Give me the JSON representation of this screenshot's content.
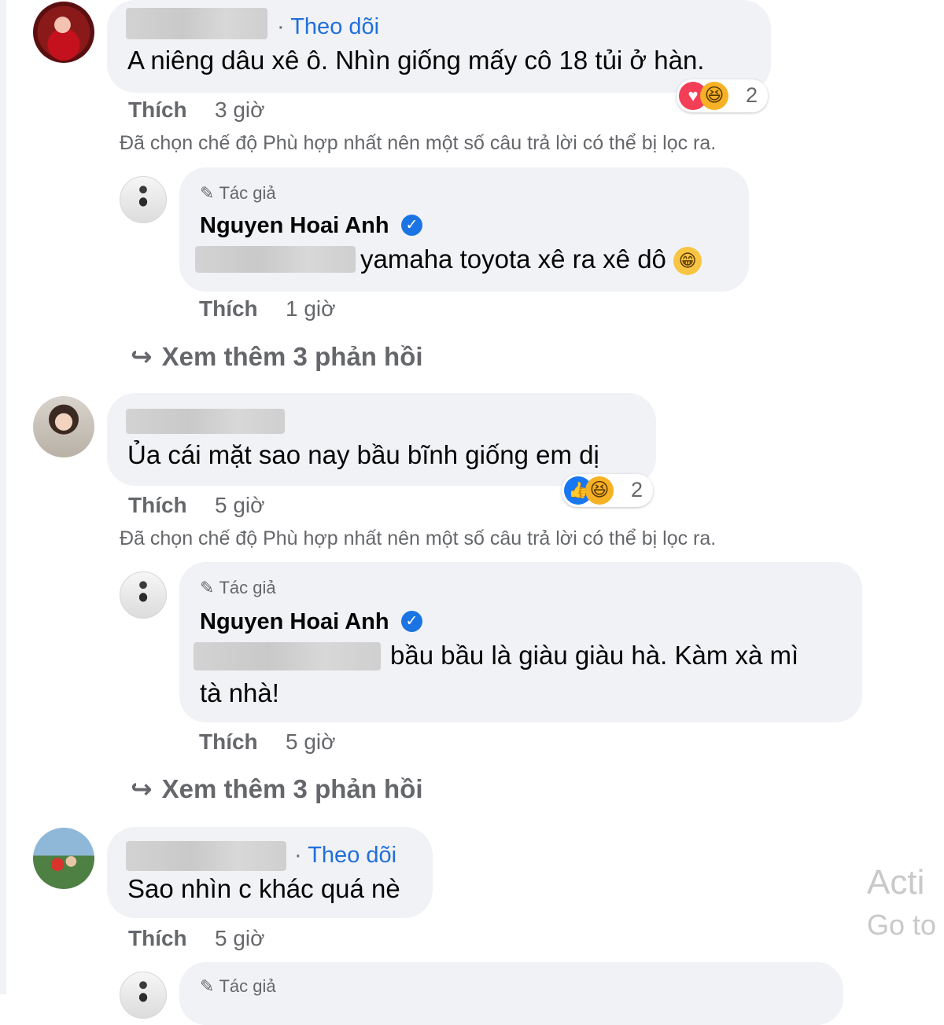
{
  "comments": [
    {
      "follow_label": "Theo dõi",
      "text": "A niêng dâu xê ô. Nhìn giống mấy cô 18 tủi ở hàn.",
      "like_label": "Thích",
      "time": "3 giờ",
      "reaction_count": "2",
      "filter_note": "Đã chọn chế độ Phù hợp nhất nên một số câu trả lời có thể bị lọc ra.",
      "reply": {
        "author_tag": "Tác giả",
        "author_name": "Nguyen Hoai Anh",
        "text": "yamaha toyota xê ra xê dô",
        "like_label": "Thích",
        "time": "1 giờ"
      },
      "more_replies": "Xem thêm 3 phản hồi"
    },
    {
      "text": "Ủa cái mặt sao nay bầu bĩnh giống em dị",
      "like_label": "Thích",
      "time": "5 giờ",
      "reaction_count": "2",
      "filter_note": "Đã chọn chế độ Phù hợp nhất nên một số câu trả lời có thể bị lọc ra.",
      "reply": {
        "author_tag": "Tác giả",
        "author_name": "Nguyen Hoai Anh",
        "text_line1": "bầu bầu là giàu giàu hà. Kàm xà mì",
        "text_line2": "tà nhà!",
        "like_label": "Thích",
        "time": "5 giờ"
      },
      "more_replies": "Xem thêm 3 phản hồi"
    },
    {
      "follow_label": "Theo dõi",
      "text": "Sao nhìn c khác quá nè",
      "like_label": "Thích",
      "time": "5 giờ",
      "reply": {
        "author_tag": "Tác giả"
      }
    }
  ],
  "watermark": {
    "line1": "Acti",
    "line2": "Go to"
  },
  "colors": {
    "link": "#216fdb",
    "muted": "#65676b",
    "bubble": "#f0f2f5",
    "verified": "#1b74e4"
  },
  "icons": [
    "verified-badge-icon",
    "love-reaction-icon",
    "haha-reaction-icon",
    "like-reaction-icon",
    "pen-icon",
    "reply-arrow-icon",
    "grin-emoji-icon"
  ]
}
